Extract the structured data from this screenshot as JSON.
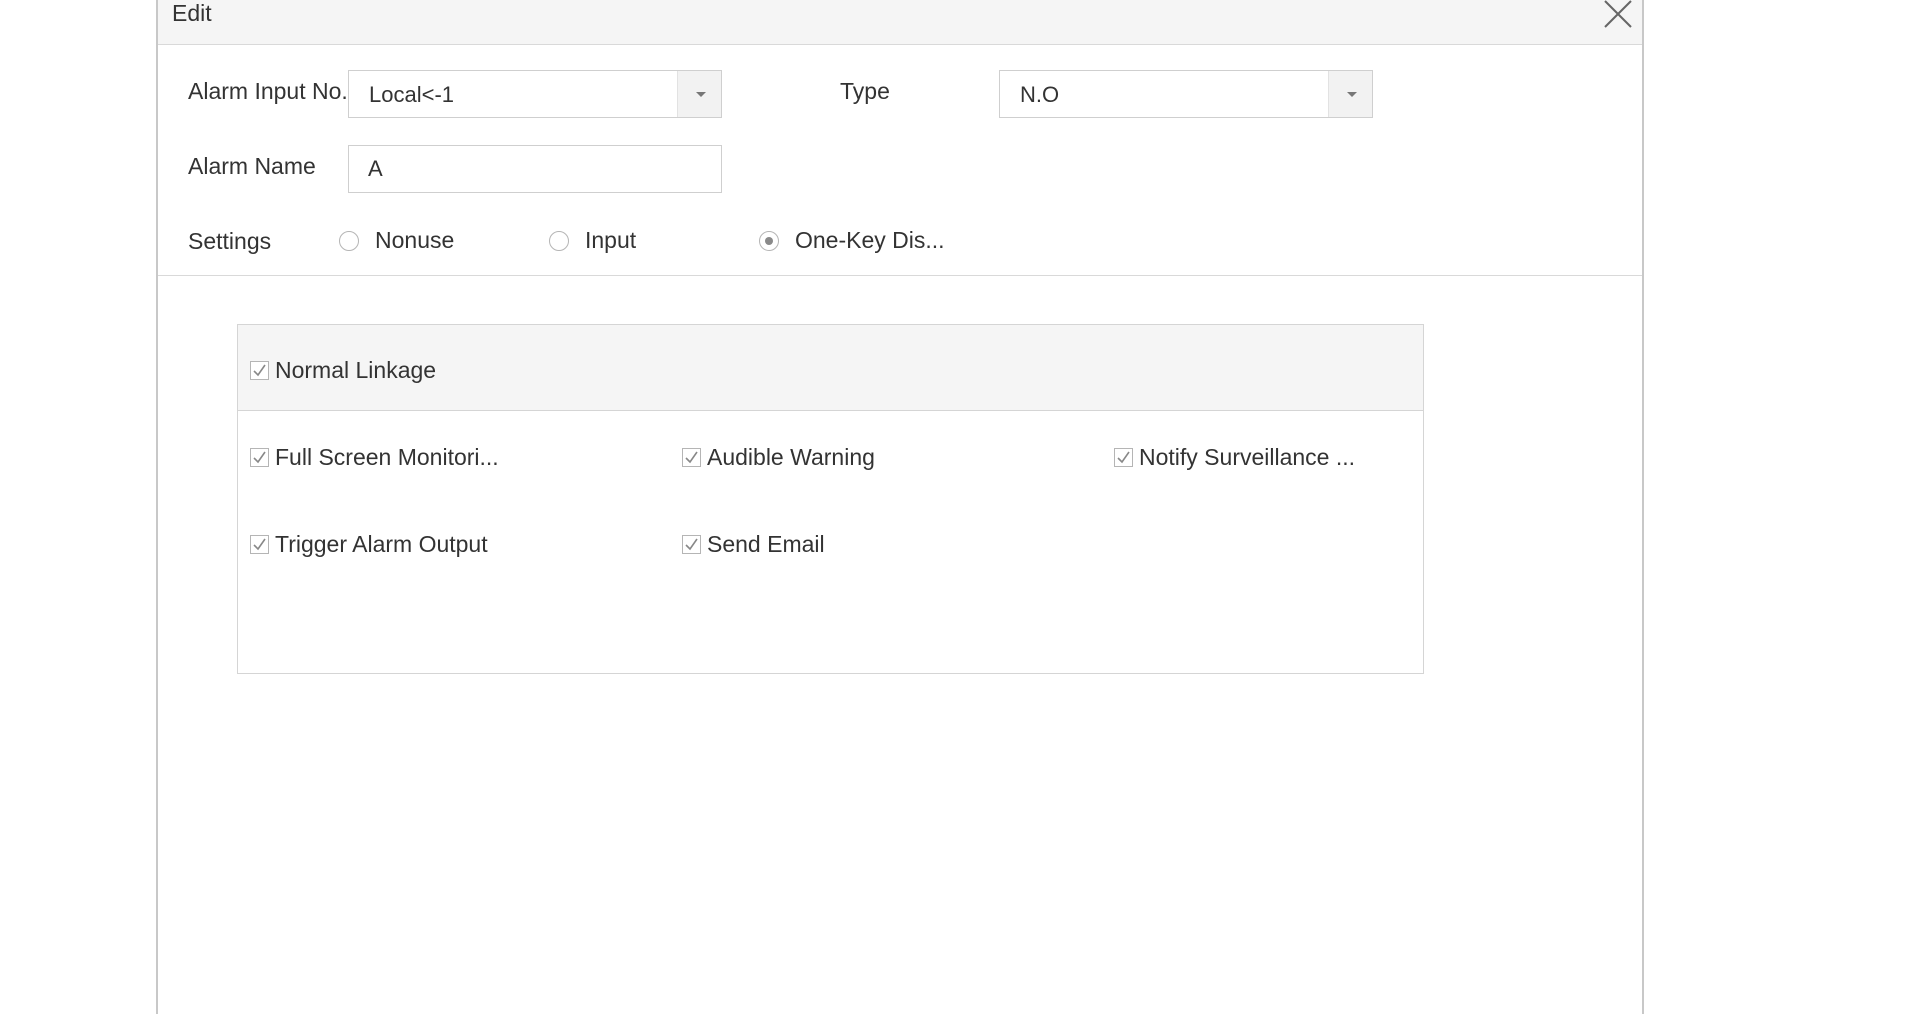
{
  "dialog": {
    "title": "Edit",
    "close_icon": "close-icon"
  },
  "form": {
    "alarm_input_no": {
      "label": "Alarm Input No.",
      "value": "Local<-1"
    },
    "type": {
      "label": "Type",
      "value": "N.O"
    },
    "alarm_name": {
      "label": "Alarm Name",
      "value": "A"
    },
    "settings": {
      "label": "Settings",
      "options": [
        {
          "label": "Nonuse",
          "selected": false
        },
        {
          "label": "Input",
          "selected": false
        },
        {
          "label": "One-Key Dis...",
          "selected": true
        }
      ]
    }
  },
  "linkage": {
    "header": {
      "label": "Normal Linkage",
      "checked": true
    },
    "items": [
      {
        "label": "Full Screen Monitori...",
        "checked": true
      },
      {
        "label": "Audible Warning",
        "checked": true
      },
      {
        "label": "Notify Surveillance ...",
        "checked": true
      },
      {
        "label": "Trigger Alarm Output",
        "checked": true
      },
      {
        "label": "Send Email",
        "checked": true
      }
    ]
  }
}
